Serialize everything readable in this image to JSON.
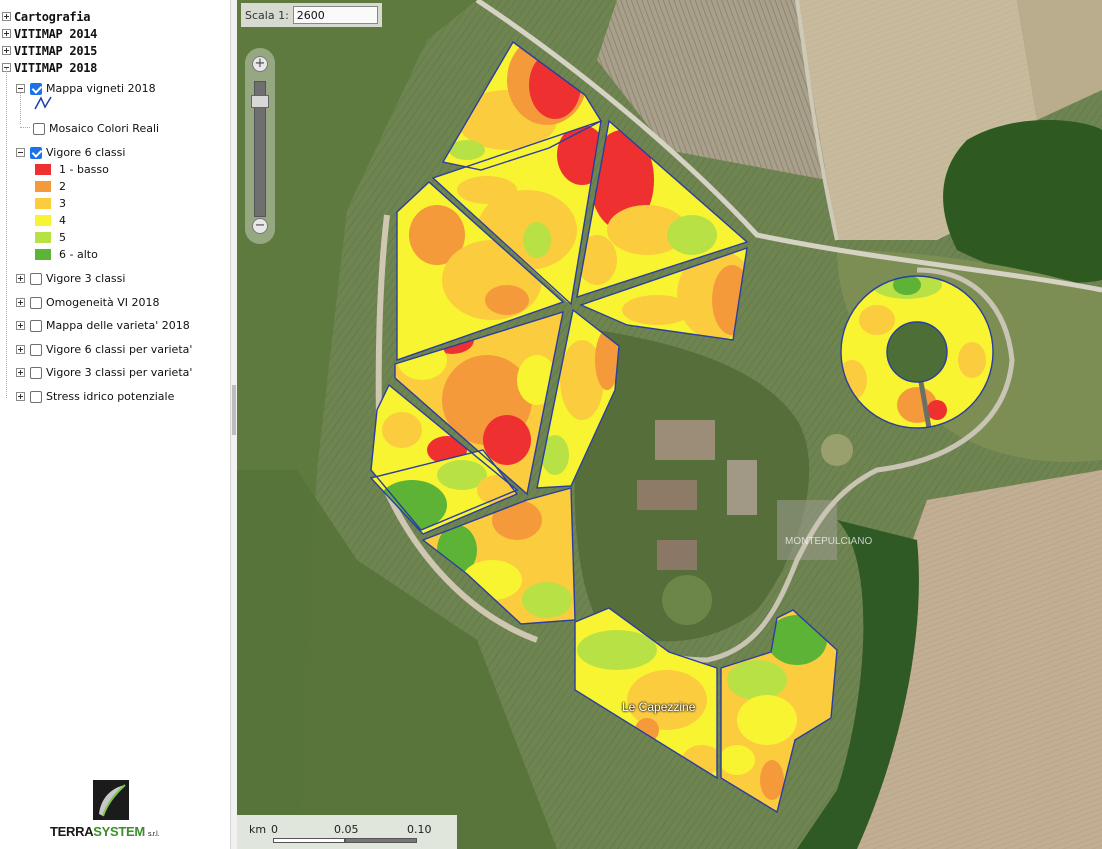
{
  "layer_tree": {
    "roots": [
      {
        "label": "Cartografia",
        "expanded": false
      },
      {
        "label": "VITIMAP 2014",
        "expanded": false
      },
      {
        "label": "VITIMAP 2015",
        "expanded": false
      },
      {
        "label": "VITIMAP 2018",
        "expanded": true
      }
    ],
    "layers": [
      {
        "label": "Mappa vigneti 2018",
        "checked": true,
        "expander": "minus"
      },
      {
        "label": "Mosaico Colori Reali",
        "checked": false,
        "expander": "none"
      },
      {
        "label": "Vigore 6 classi",
        "checked": true,
        "expander": "minus"
      },
      {
        "label": "Vigore 3 classi",
        "checked": false,
        "expander": "plus"
      },
      {
        "label": "Omogeneità VI 2018",
        "checked": false,
        "expander": "plus"
      },
      {
        "label": "Mappa delle varieta' 2018",
        "checked": false,
        "expander": "plus"
      },
      {
        "label": "Vigore 6 classi per varieta'",
        "checked": false,
        "expander": "plus"
      },
      {
        "label": "Vigore 3 classi per varieta'",
        "checked": false,
        "expander": "plus"
      },
      {
        "label": "Stress idrico potenziale",
        "checked": false,
        "expander": "plus"
      }
    ],
    "legend": [
      {
        "label": "1 - basso",
        "color": "#ee3030"
      },
      {
        "label": "2",
        "color": "#f49a3a"
      },
      {
        "label": "3",
        "color": "#fbcc3e"
      },
      {
        "label": "4",
        "color": "#f8f431"
      },
      {
        "label": "5",
        "color": "#b8e145"
      },
      {
        "label": "6 - alto",
        "color": "#5db335"
      }
    ],
    "mappa_vigneti_icon": "polyline-icon"
  },
  "logo": {
    "brand_a": "TERRA",
    "brand_b": "SYSTEM",
    "suffix": "s.r.l."
  },
  "map": {
    "scale_label": "Scala 1:",
    "scale_value": "2600",
    "scalebar_unit": "km",
    "scalebar_ticks": [
      "0",
      "0.05",
      "0.10"
    ],
    "place_label": "Le Capezzine",
    "watermark": "MONTEPULCIANO"
  }
}
